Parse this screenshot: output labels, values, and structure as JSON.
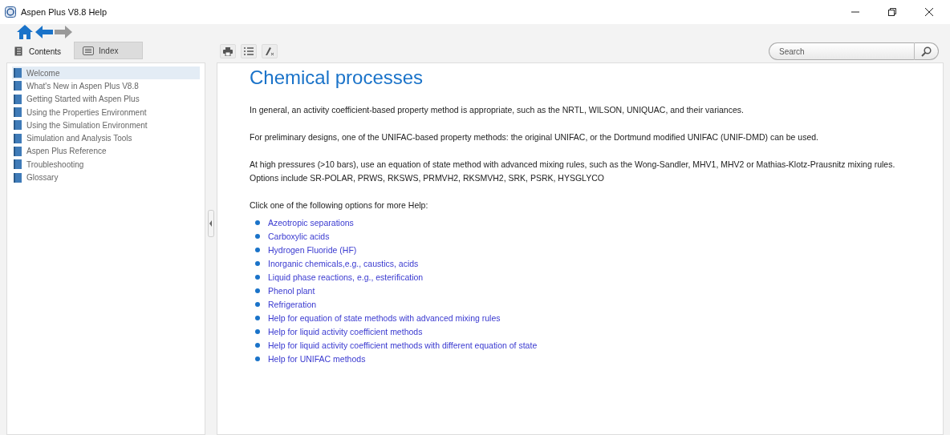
{
  "window": {
    "title": "Aspen Plus V8.8 Help"
  },
  "tabs": [
    {
      "label": "Contents",
      "selected": true
    },
    {
      "label": "Index",
      "selected": false
    }
  ],
  "sidebar": {
    "items": [
      {
        "label": "Welcome",
        "selected": true
      },
      {
        "label": "What's New in Aspen Plus V8.8",
        "selected": false
      },
      {
        "label": "Getting Started with Aspen Plus",
        "selected": false
      },
      {
        "label": "Using the Properties Environment",
        "selected": false
      },
      {
        "label": "Using the Simulation Environment",
        "selected": false
      },
      {
        "label": "Simulation and Analysis Tools",
        "selected": false
      },
      {
        "label": "Aspen Plus Reference",
        "selected": false
      },
      {
        "label": "Troubleshooting",
        "selected": false
      },
      {
        "label": "Glossary",
        "selected": false
      }
    ]
  },
  "search": {
    "placeholder": "Search"
  },
  "article": {
    "title": "Chemical processes",
    "paragraphs": [
      "In general, an activity coefficient-based property method is appropriate, such as the NRTL, WILSON, UNIQUAC, and their variances.",
      "For preliminary designs, one of the UNIFAC-based property methods: the original UNIFAC, or the Dortmund modified UNIFAC (UNIF-DMD) can be used.",
      "At high pressures (>10 bars), use an equation of state method with advanced mixing rules, such as the Wong-Sandler, MHV1, MHV2 or Mathias-Klotz-Prausnitz mixing rules. Options include SR-POLAR, PRWS, RKSWS, PRMVH2, RKSMVH2, SRK, PSRK, HYSGLYCO",
      "Click one of the following options for more Help:"
    ],
    "links": [
      "Azeotropic separations",
      "Carboxylic acids",
      "Hydrogen Fluoride (HF)",
      "Inorganic chemicals,e.g., caustics, acids",
      "Liquid phase reactions, e.g., esterification",
      "Phenol plant",
      "Refrigeration",
      "Help for equation of state methods with advanced mixing rules",
      "Help for liquid activity coefficient methods",
      "Help for liquid activity coefficient methods with different equation of state",
      "Help for UNIFAC methods"
    ]
  }
}
